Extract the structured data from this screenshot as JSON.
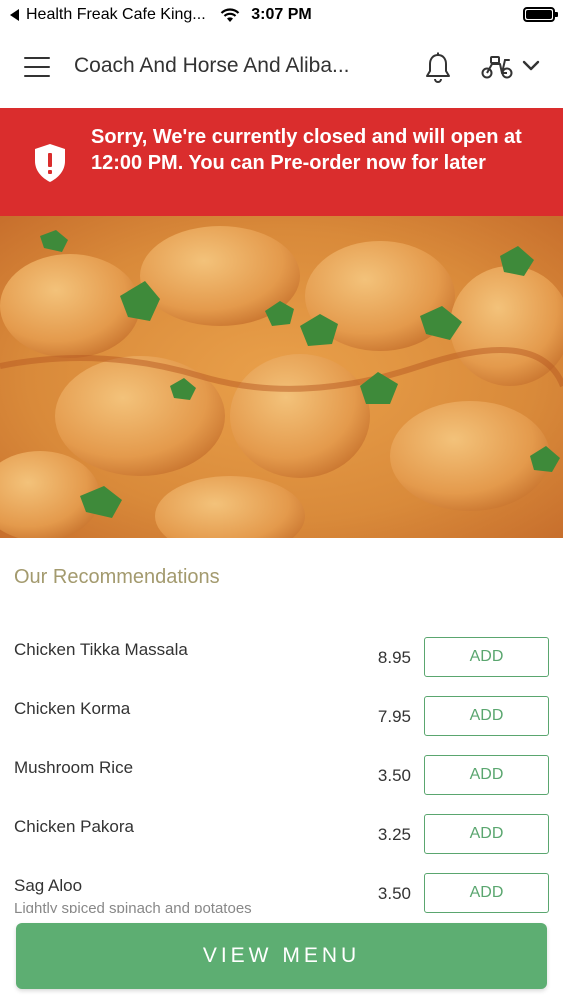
{
  "status_bar": {
    "back_app": "Health Freak Cafe King...",
    "time": "3:07 PM"
  },
  "header": {
    "title": "Coach And Horse And Aliba...",
    "icons": [
      "menu-icon",
      "bell-icon",
      "scooter-icon",
      "chevron-down-icon"
    ]
  },
  "banner": {
    "message": "Sorry, We're currently closed and will open at 12:00 PM. You can Pre-order now for later",
    "icon": "shield-alert-icon",
    "color": "#da2d2d"
  },
  "recommendations": {
    "title": "Our Recommendations",
    "items": [
      {
        "name": "Chicken Tikka Massala",
        "price": "8.95",
        "action": "ADD"
      },
      {
        "name": "Chicken Korma",
        "price": "7.95",
        "action": "ADD"
      },
      {
        "name": "Mushroom Rice",
        "price": "3.50",
        "action": "ADD"
      },
      {
        "name": "Chicken Pakora",
        "price": "3.25",
        "action": "ADD"
      },
      {
        "name": "Sag Aloo",
        "description": "Lightly spiced spinach and potatoes",
        "price": "3.50",
        "action": "ADD"
      }
    ]
  },
  "footer": {
    "view_menu_label": "VIEW MENU"
  },
  "colors": {
    "accent_green": "#5dae72",
    "section_title": "#a39a6e",
    "banner_red": "#da2d2d"
  }
}
